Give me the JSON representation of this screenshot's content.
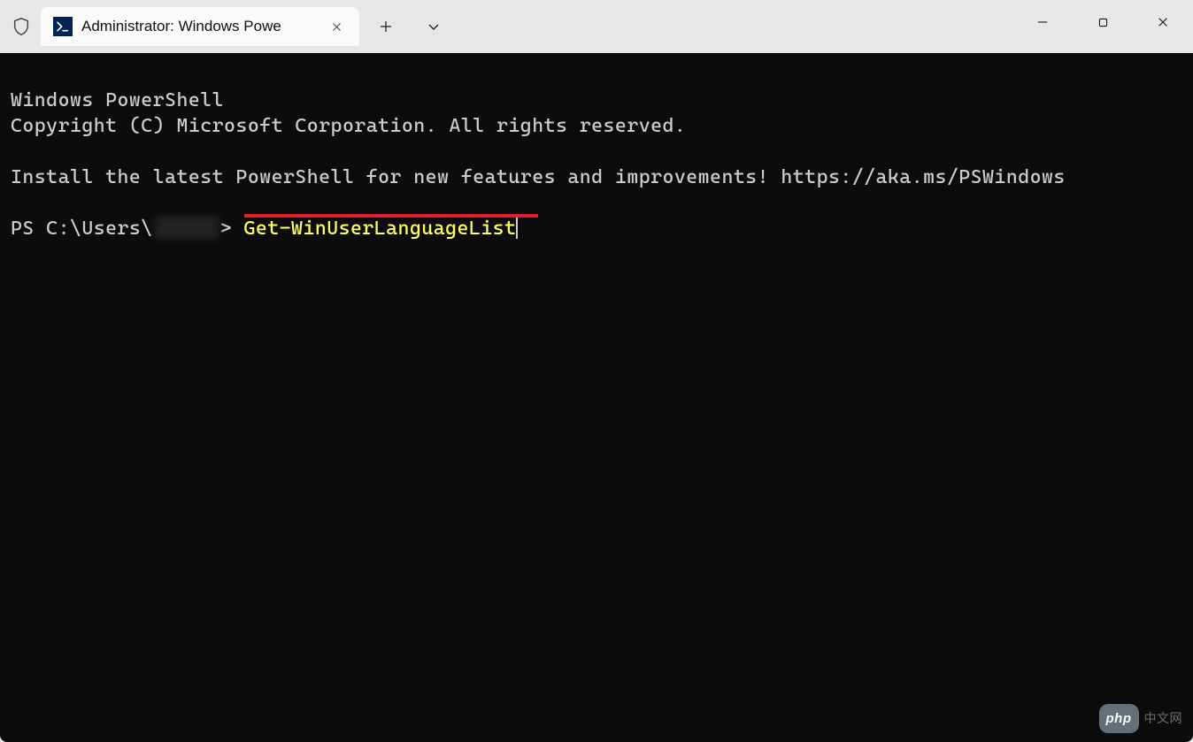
{
  "titlebar": {
    "tab_title": "Administrator: Windows Powe",
    "close_glyph": "✕",
    "new_tab_glyph": "+",
    "dropdown_glyph": "⌄",
    "min_glyph": "—",
    "max_glyph": "▢",
    "win_close_glyph": "✕"
  },
  "terminal": {
    "line_1": "Windows PowerShell",
    "line_2": "Copyright (C) Microsoft Corporation. All rights reserved.",
    "line_3": "Install the latest PowerShell for new features and improvements! https://aka.ms/PSWindows",
    "prompt_prefix": "PS C:\\Users\\",
    "prompt_suffix": "> ",
    "command": "Get-WinUserLanguageList"
  },
  "watermark": {
    "logo_text": "php",
    "text": "中文网"
  }
}
